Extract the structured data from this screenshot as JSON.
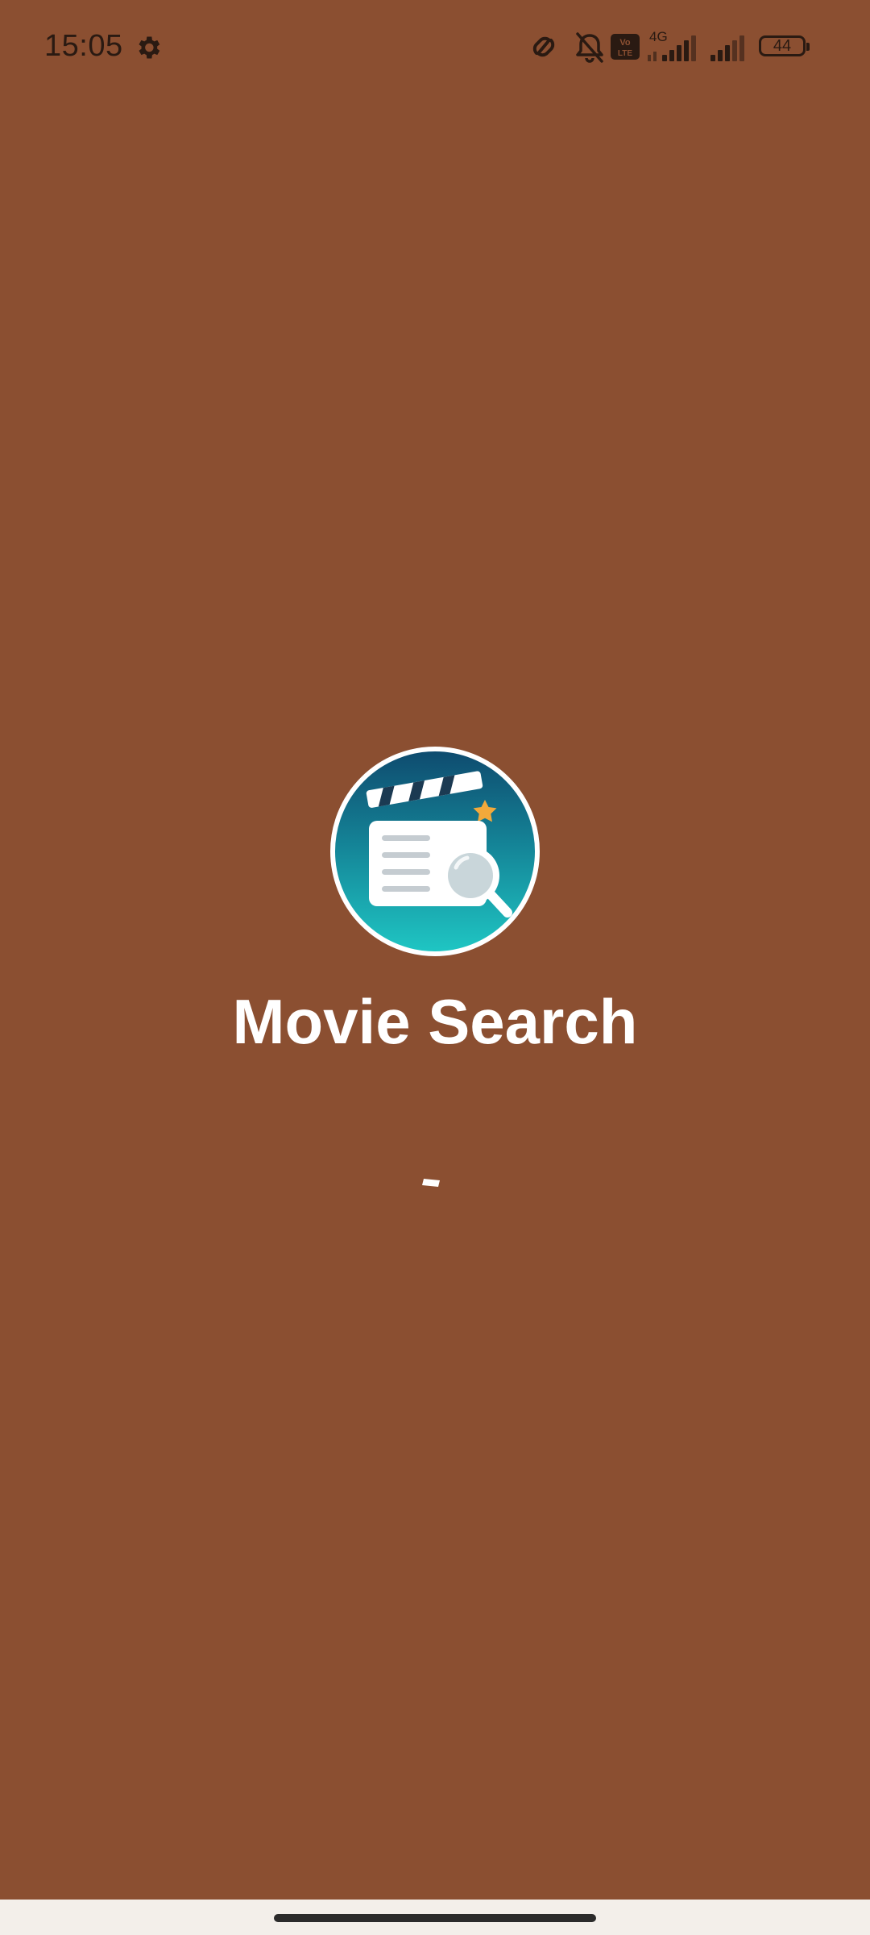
{
  "status_bar": {
    "time": "15:05",
    "network_type": "4G",
    "volte_label": "Vo LTE",
    "battery_level": "44",
    "icons": [
      "gear-icon",
      "link-icon",
      "bell-off-icon",
      "volte-icon",
      "signal-icon",
      "signal-icon",
      "battery-icon"
    ]
  },
  "splash": {
    "app_name": "Movie Search",
    "logo_icon": "movie-search-logo-icon",
    "loading_indicator": "spinner"
  },
  "colors": {
    "background": "#8B4F31",
    "title": "#FFFFFF",
    "nav_bar": "#F3EFEA",
    "logo_gradient_top": "#0E4A6E",
    "logo_gradient_bottom": "#1FC7C4",
    "star": "#F2A93B"
  }
}
